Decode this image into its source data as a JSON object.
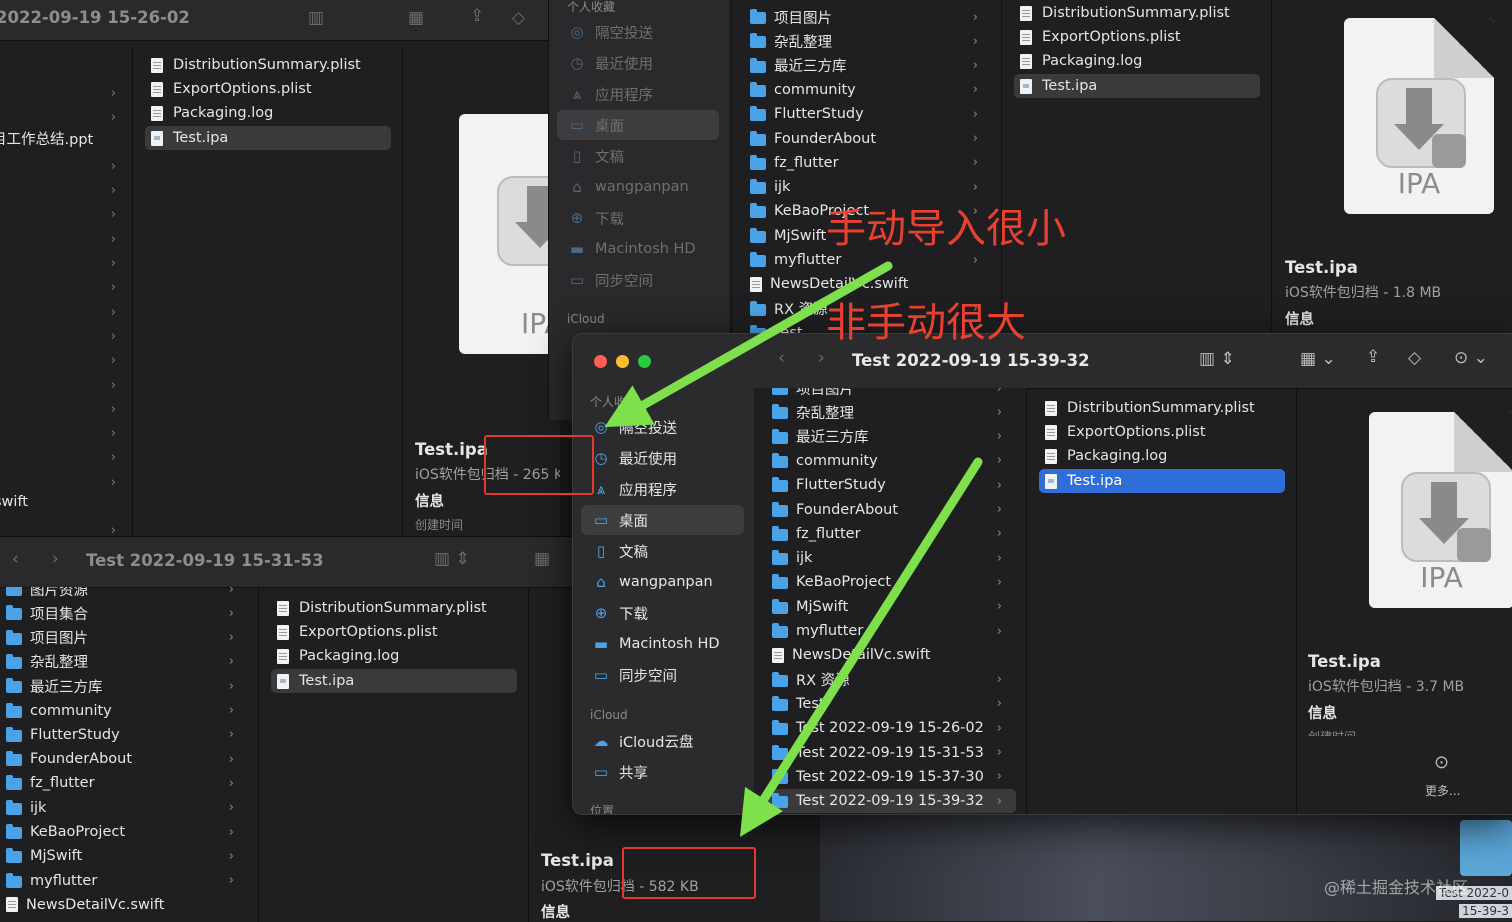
{
  "winA": {
    "title": "2022-09-19 15-26-02",
    "sidebar_fragments": [
      "目工作总结.ppt",
      "swift"
    ],
    "files": [
      "DistributionSummary.plist",
      "ExportOptions.plist",
      "Packaging.log",
      "Test.ipa"
    ],
    "preview": {
      "name": "Test.ipa",
      "meta": "iOS软件包归档 - 265 KB",
      "info": "信息",
      "created": "创建时间",
      "icon_text": "IPA"
    }
  },
  "winB": {
    "title": "Test 2022-09-19 15-31-53",
    "folders": [
      "图片资源",
      "项目集合",
      "项目图片",
      "杂乱整理",
      "最近三方库",
      "community",
      "FlutterStudy",
      "FounderAbout",
      "fz_flutter",
      "ijk",
      "KeBaoProject",
      "MjSwift",
      "myflutter",
      "NewsDetailVc.swift"
    ],
    "files": [
      "DistributionSummary.plist",
      "ExportOptions.plist",
      "Packaging.log",
      "Test.ipa"
    ],
    "preview": {
      "name": "Test.ipa",
      "meta": "iOS软件包归档 - 582 KB",
      "info": "信息"
    }
  },
  "winC": {
    "sidebar_header": "个人收藏",
    "sidebar": [
      "隔空投送",
      "最近使用",
      "应用程序",
      "桌面",
      "文稿",
      "wangpanpan",
      "下载",
      "Macintosh HD",
      "同步空间"
    ],
    "icloud_header": "iCloud",
    "folders": [
      "项目图片",
      "杂乱整理",
      "最近三方库",
      "community",
      "FlutterStudy",
      "FounderAbout",
      "fz_flutter",
      "ijk",
      "KeBaoProject",
      "MjSwift",
      "myflutter",
      "NewsDetailVc.swift",
      "RX 资源",
      "Test"
    ],
    "files": [
      "DistributionSummary.plist",
      "ExportOptions.plist",
      "Packaging.log",
      "Test.ipa"
    ],
    "preview": {
      "name": "Test.ipa",
      "meta": "iOS软件包归档 - 1.8 MB",
      "info": "信息",
      "icon_text": "IPA"
    }
  },
  "winD": {
    "title": "Test 2022-09-19 15-39-32",
    "sidebar_header": "个人收藏",
    "sidebar": [
      "隔空投送",
      "最近使用",
      "应用程序",
      "桌面",
      "文稿",
      "wangpanpan",
      "下载",
      "Macintosh HD",
      "同步空间"
    ],
    "icloud_header": "iCloud",
    "icloud": [
      "iCloud云盘",
      "共享"
    ],
    "location_header": "位置",
    "folders": [
      "项目图片",
      "杂乱整理",
      "最近三方库",
      "community",
      "FlutterStudy",
      "FounderAbout",
      "fz_flutter",
      "ijk",
      "KeBaoProject",
      "MjSwift",
      "myflutter",
      "NewsDetailVc.swift",
      "RX 资源",
      "Test",
      "Test 2022-09-19 15-26-02",
      "Test 2022-09-19 15-31-53",
      "Test 2022-09-19 15-37-30",
      "Test 2022-09-19 15-39-32"
    ],
    "files": [
      "DistributionSummary.plist",
      "ExportOptions.plist",
      "Packaging.log",
      "Test.ipa"
    ],
    "preview": {
      "name": "Test.ipa",
      "meta": "iOS软件包归档 - 3.7 MB",
      "info": "信息",
      "created": "创建时间",
      "more": "更多...",
      "icon_text": "IPA"
    }
  },
  "annotations": {
    "manual": "手动导入很小",
    "non_manual": "非手动很大"
  },
  "desktop": {
    "folder_label": "Test 2022-0",
    "folder_label2": "15-39-3"
  },
  "watermark": "@稀土掘金技术社区",
  "colors": {
    "accent": "#2f6ed8",
    "folder": "#4aa3e8",
    "annotation": "#e8412f",
    "arrow": "#7ee04a"
  }
}
